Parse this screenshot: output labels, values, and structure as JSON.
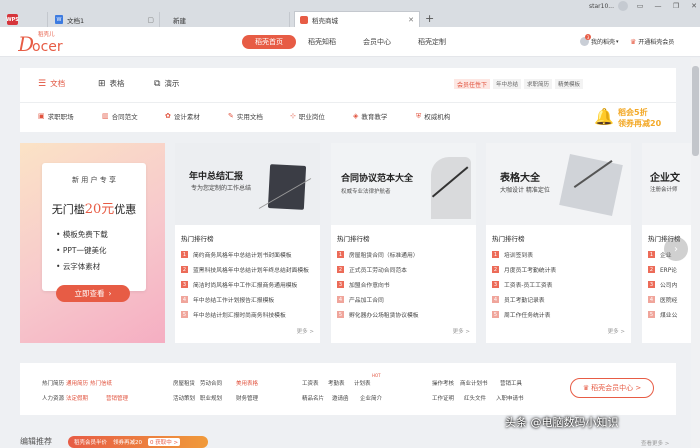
{
  "browser": {
    "tabs": [
      {
        "icon": "WPS",
        "label": "WPS"
      },
      {
        "icon": "W",
        "label": "文档1"
      },
      {
        "label": "新建"
      },
      {
        "label": "稻壳商城"
      }
    ],
    "new_tab": "+",
    "user": "star10..."
  },
  "header": {
    "logo_text": "稻壳儿",
    "nav": [
      "稻壳首页",
      "稻壳知稻",
      "会员中心",
      "稻壳定制"
    ],
    "my_docer": "我的稻壳",
    "open_vip": "开通稻壳会员",
    "badge": "3"
  },
  "categories": [
    "文档",
    "表格",
    "演示"
  ],
  "tags": {
    "highlight": "会员任性下",
    "items": [
      "年中总结",
      "求职简历",
      "精美模板"
    ]
  },
  "subnav": [
    "求职职场",
    "合同范文",
    "设计素材",
    "实用文档",
    "职业岗位",
    "教育教学",
    "权威机构"
  ],
  "discount": {
    "line1": "稻会5折",
    "line2": "领券再减20"
  },
  "promo": {
    "header": "新 用 户 专 享",
    "title_a": "无门槛",
    "title_amt": "20元",
    "title_b": "优惠",
    "features": [
      "模板免费下载",
      "PPT一键美化",
      "云字体素材"
    ],
    "cta": "立即查看"
  },
  "banners": [
    {
      "title": "年中总结汇报",
      "subtitle": "专为您定制的工作总结",
      "list_title": "热门排行榜",
      "more": "更多 >",
      "items": [
        "简约商务风格年中总结计划书封面模板",
        "蓝黑科技风格年中总结计划年终总结封面模板",
        "简洁时尚风格年中工作汇报商务通用模板",
        "年中总结工作计划报告汇报模板",
        "年中总结计划汇报时尚商务科技模板"
      ]
    },
    {
      "title": "合同协议范本大全",
      "subtitle": "权威专业法律护航者",
      "list_title": "热门排行榜",
      "more": "更多 >",
      "items": [
        "房屋租赁合同（标准通用）",
        "正式员工劳动合同范本",
        "加盟合作意向书",
        "产品加工合同",
        "孵化器办公场租赁协议模板"
      ]
    },
    {
      "title": "表格大全",
      "subtitle": "大咖设计 精准定位",
      "list_title": "热门排行榜",
      "more": "更多 >",
      "items": [
        "培训签到表",
        "月度员工考勤统计表",
        "工资表-员工工资表",
        "员工考勤记录表",
        "周工作任务统计表"
      ]
    },
    {
      "title": "企业文",
      "subtitle": "注册会计师",
      "list_title": "热门排行榜",
      "more": "更多 >",
      "items": [
        "企业",
        "ERP论",
        "公司内",
        "医院经",
        "煤业公"
      ]
    }
  ],
  "links": {
    "rows": [
      [
        {
          "t": "热门简历"
        },
        {
          "t": "通用简历",
          "red": true
        },
        {
          "t": "热门信纸",
          "red": true
        },
        {
          "t": "房屋租赁"
        },
        {
          "t": "劳动合同"
        },
        {
          "t": "美用表格",
          "red": true
        },
        {
          "t": "工资表"
        },
        {
          "t": "考勤表"
        },
        {
          "t": "计划表"
        },
        {
          "t": "操作考核"
        },
        {
          "t": "商业计划书"
        },
        {
          "t": "营销工具"
        }
      ],
      [
        {
          "t": "人力资源"
        },
        {
          "t": "法定假期",
          "red": true
        },
        {
          "t": "营销管理",
          "red": true
        },
        {
          "t": "活动策划"
        },
        {
          "t": "职业规划"
        },
        {
          "t": "财务管理"
        },
        {
          "t": "精品名片"
        },
        {
          "t": "邀请函"
        },
        {
          "t": "企业简介"
        },
        {
          "t": "工作证明"
        },
        {
          "t": "红头文件"
        },
        {
          "t": "入职申请书"
        }
      ]
    ],
    "hot": "HOT",
    "vip_button": "稻壳会员中心 >"
  },
  "bottom": {
    "title": "编辑推荐",
    "promo_text": "稻壳会员半价",
    "promo_text2": "领券再减20",
    "promo_tag": "0 获取中 >",
    "more": "查看更多 >"
  },
  "watermark": "头条 @电脑数码小知识",
  "colors": {
    "accent": "#e75c45",
    "link_red": "#e1533e",
    "icon_blue": "#3d7be0"
  }
}
